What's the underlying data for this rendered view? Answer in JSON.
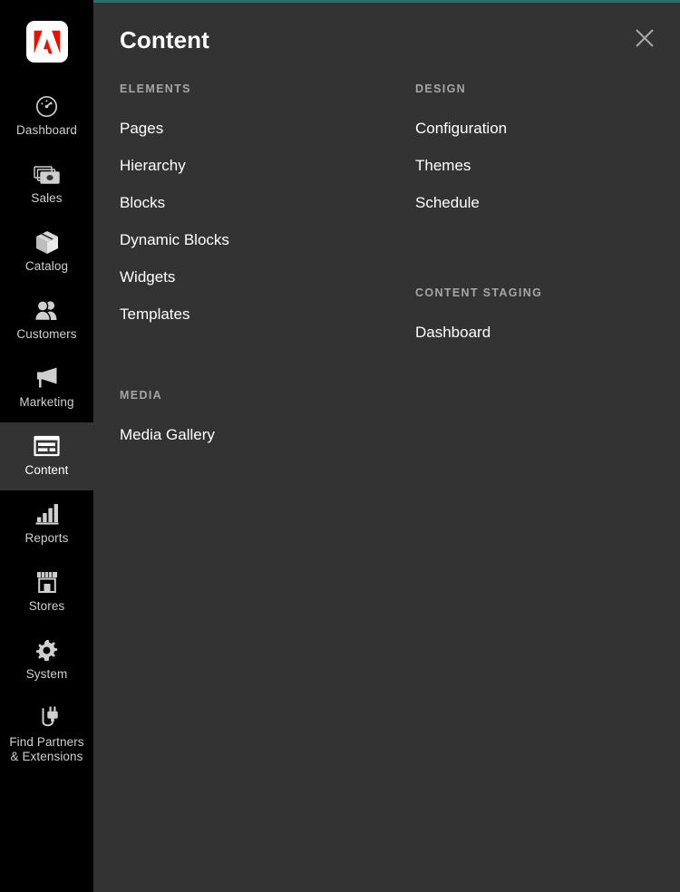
{
  "theme": {
    "sidebar_bg": "#000000",
    "panel_bg": "#333333",
    "accent_top_line": "#2b6f6b",
    "logo_red": "#eb1000",
    "label_gray": "#cfcfcf",
    "group_title_gray": "#a6a6a6",
    "link_white": "#ffffff"
  },
  "sidebar": {
    "logo": {
      "icon": "adobe-logo-icon",
      "alt": "Adobe"
    },
    "items": [
      {
        "label": "Dashboard",
        "icon": "dashboard-gauge-icon",
        "active": false
      },
      {
        "label": "Sales",
        "icon": "sales-money-icon",
        "active": false
      },
      {
        "label": "Catalog",
        "icon": "catalog-box-icon",
        "active": false
      },
      {
        "label": "Customers",
        "icon": "customers-people-icon",
        "active": false
      },
      {
        "label": "Marketing",
        "icon": "marketing-megaphone-icon",
        "active": false
      },
      {
        "label": "Content",
        "icon": "content-layout-icon",
        "active": true
      },
      {
        "label": "Reports",
        "icon": "reports-barchart-icon",
        "active": false
      },
      {
        "label": "Stores",
        "icon": "stores-storefront-icon",
        "active": false
      },
      {
        "label": "System",
        "icon": "system-gear-icon",
        "active": false
      },
      {
        "label": "Find Partners\n& Extensions",
        "icon": "partners-plug-icon",
        "active": false
      }
    ]
  },
  "panel": {
    "title": "Content",
    "close": {
      "icon": "close-icon",
      "label": "Close"
    },
    "groups": {
      "elements": {
        "title": "ELEMENTS",
        "links": [
          {
            "label": "Pages"
          },
          {
            "label": "Hierarchy"
          },
          {
            "label": "Blocks"
          },
          {
            "label": "Dynamic Blocks"
          },
          {
            "label": "Widgets"
          },
          {
            "label": "Templates"
          }
        ]
      },
      "media": {
        "title": "MEDIA",
        "links": [
          {
            "label": "Media Gallery"
          }
        ]
      },
      "design": {
        "title": "DESIGN",
        "links": [
          {
            "label": "Configuration"
          },
          {
            "label": "Themes"
          },
          {
            "label": "Schedule"
          }
        ]
      },
      "content_staging": {
        "title": "CONTENT STAGING",
        "links": [
          {
            "label": "Dashboard"
          }
        ]
      }
    }
  }
}
